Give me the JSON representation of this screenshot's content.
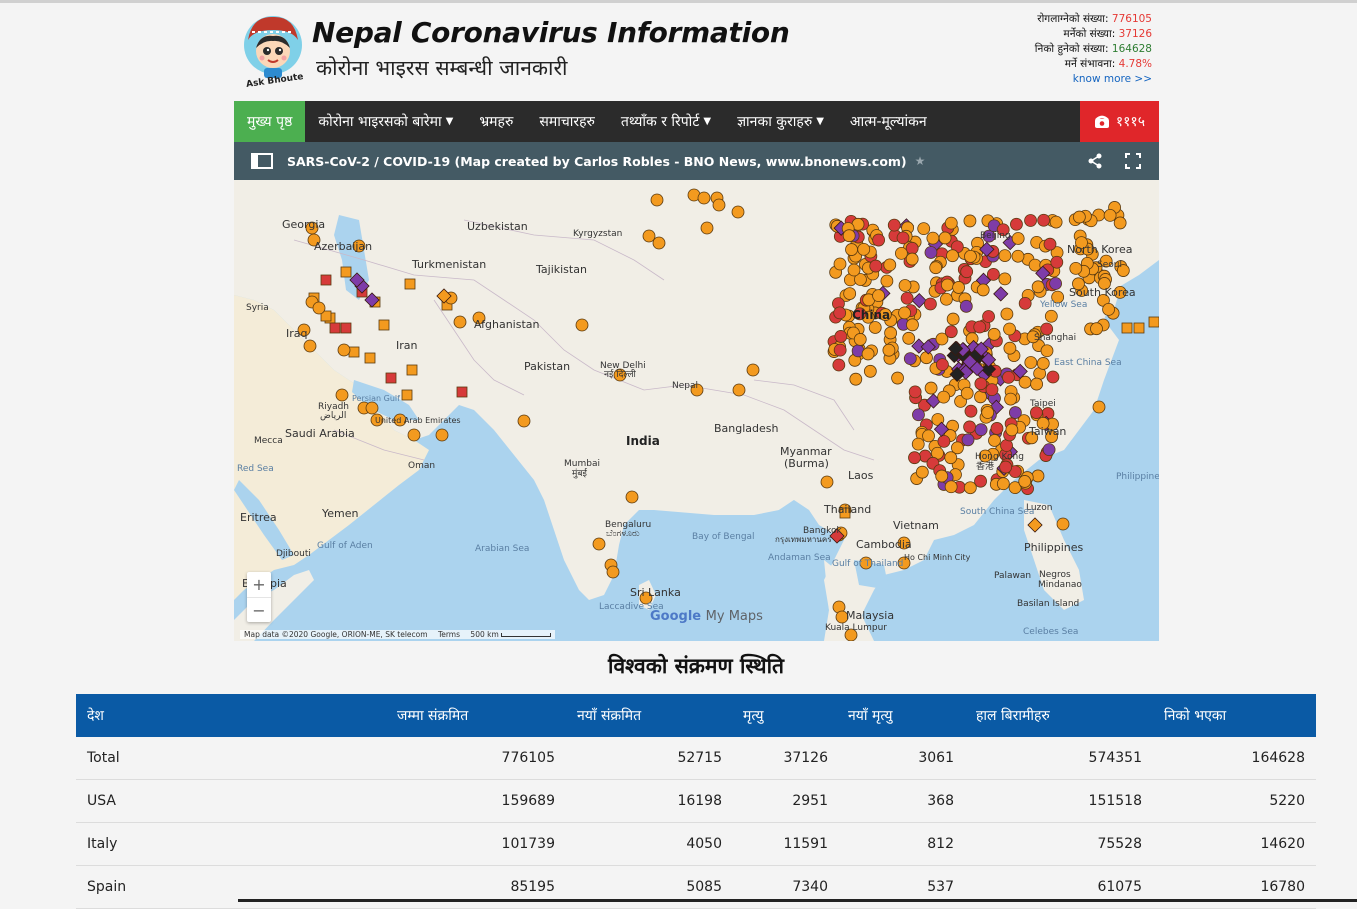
{
  "site": {
    "title": "Nepal Coronavirus Information",
    "subtitle": "कोरोना भाइरस सम्बन्धी जानकारी",
    "logo_caption": "Ask Bhoute"
  },
  "stats": {
    "infected_label": "रोगलाग्नेको संख्या:",
    "infected_value": "776105",
    "deaths_label": "मर्नेको संख्या:",
    "deaths_value": "37126",
    "recovered_label": "निको हुनेको संख्या:",
    "recovered_value": "164628",
    "death_rate_label": "मर्ने संभावना:",
    "death_rate_value": "4.78%",
    "know_more": "know more >>"
  },
  "nav": {
    "items": [
      {
        "label": "मुख्य पृष्ठ",
        "active": true,
        "dropdown": false
      },
      {
        "label": "कोरोना भाइरसको बारेमा",
        "active": false,
        "dropdown": true
      },
      {
        "label": "भ्रमहरु",
        "active": false,
        "dropdown": false
      },
      {
        "label": "समाचारहरु",
        "active": false,
        "dropdown": false
      },
      {
        "label": "तथ्याँक र रिपोर्ट",
        "active": false,
        "dropdown": true
      },
      {
        "label": "ज्ञानका कुराहरु",
        "active": false,
        "dropdown": true
      },
      {
        "label": "आत्म-मूल्यांकन",
        "active": false,
        "dropdown": false
      }
    ],
    "hotline": "१११५"
  },
  "map": {
    "title": "SARS-CoV-2 / COVID-19 (Map created by Carlos Robles - BNO News, www.bnonews.com)",
    "attribution": "Map data ©2020 Google, ORION-ME, SK telecom",
    "terms": "Terms",
    "scale": "500 km",
    "google_logo": "Google",
    "google_logo_suffix": "My Maps",
    "labels": {
      "georgia": "Georgia",
      "azerbaijan": "Azerbaijan",
      "uzbekistan": "Uzbekistan",
      "kyrgyzstan": "Kyrgyzstan",
      "turkmenistan": "Turkmenistan",
      "tajikistan": "Tajikistan",
      "syria": "Syria",
      "iraq": "Iraq",
      "iran": "Iran",
      "afghanistan": "Afghanistan",
      "pakistan": "Pakistan",
      "new_delhi": "New Delhi",
      "new_delhi_dev": "नई दिल्ली",
      "nepal": "Nepal",
      "india": "India",
      "bangladesh": "Bangladesh",
      "riyadh": "Riyadh",
      "riyadh_ar": "الرياض",
      "saudi_arabia": "Saudi Arabia",
      "mecca": "Mecca",
      "oman": "Oman",
      "mumbai": "Mumbai",
      "mumbai_dev": "मुंबई",
      "red_sea": "Red Sea",
      "eritrea": "Eritrea",
      "yemen": "Yemen",
      "gulf_of_aden": "Gulf of Aden",
      "arabian_sea": "Arabian Sea",
      "djibouti": "Djibouti",
      "ethiopia": "Ethiopia",
      "bengaluru": "Bengaluru",
      "bengaluru_kn": "ಬೆಂಗಳೂರು",
      "sri_lanka": "Sri Lanka",
      "laccadive_sea": "Laccadive Sea",
      "bay_of_bengal": "Bay of Bengal",
      "myanmar": "Myanmar",
      "burma": "(Burma)",
      "laos": "Laos",
      "thailand": "Thailand",
      "bangkok": "Bangkok",
      "bangkok_th": "กรุงเทพมหานคร",
      "andaman_sea": "Andaman Sea",
      "gulf_of_thailand": "Gulf of Thailand",
      "vietnam": "Vietnam",
      "cambodia": "Cambodia",
      "ho_chi_minh": "Ho Chi Minh City",
      "malaysia": "Malaysia",
      "kuala_lumpur": "Kuala Lumpur",
      "china": "China",
      "beijing": "Beijing",
      "north_korea": "North Korea",
      "seoul": "Seoul",
      "south_korea": "South Korea",
      "yellow_sea": "Yellow Sea",
      "shanghai": "Shanghai",
      "east_china_sea": "East China Sea",
      "taipei": "Taipei",
      "taiwan": "Taiwan",
      "hong_kong": "Hong Kong",
      "hong_kong_zh": "香港",
      "philippines": "Philippines",
      "philippine_sea": "Philippine",
      "luzon": "Luzon",
      "south_china_sea": "South China Sea",
      "palawan": "Palawan",
      "negros": "Negros",
      "mindanao": "Mindanao",
      "basilan": "Basilan Island",
      "celebes_sea": "Celebes Sea",
      "persian_gulf": "Persian Gulf",
      "united_arab": "United Arab Emirates"
    }
  },
  "table": {
    "title": "विश्वको संक्रमण स्थिति",
    "headers": [
      "देश",
      "जम्मा संक्रमित",
      "नयाँ संक्रमित",
      "मृत्यु",
      "नयाँ मृत्यु",
      "हाल बिरामीहरु",
      "निको भएका"
    ],
    "rows": [
      [
        "Total",
        "776105",
        "52715",
        "37126",
        "3061",
        "574351",
        "164628"
      ],
      [
        "USA",
        "159689",
        "16198",
        "2951",
        "368",
        "151518",
        "5220"
      ],
      [
        "Italy",
        "101739",
        "4050",
        "11591",
        "812",
        "75528",
        "14620"
      ],
      [
        "Spain",
        "85195",
        "5085",
        "7340",
        "537",
        "61075",
        "16780"
      ]
    ]
  },
  "colors": {
    "nav_bg": "#2b2b2b",
    "nav_active": "#4caf50",
    "hotline_bg": "#e0262a",
    "map_bar": "#445a64",
    "table_header": "#0a5aa5",
    "marker_orange": "#f39a1f",
    "marker_red": "#d63a3a",
    "marker_purple": "#7e3ca8"
  },
  "icons": {
    "panel": "panel-toggle-icon",
    "share": "share-icon",
    "fullscreen": "fullscreen-icon",
    "phone": "phone-icon",
    "zoom_in": "plus-icon",
    "zoom_out": "minus-icon"
  },
  "zoom": {
    "in": "+",
    "out": "−"
  }
}
